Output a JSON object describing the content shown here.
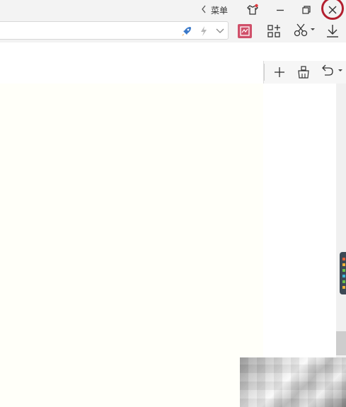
{
  "titlebar": {
    "menu_label": "菜单",
    "icons": [
      "chevron-left-icon",
      "skin-shirt-icon",
      "minimize-icon",
      "restore-icon",
      "close-icon"
    ],
    "close_highlight_color": "#b32030"
  },
  "address_bar": {
    "value": "",
    "icons": [
      "rocket-icon",
      "lightning-icon",
      "chevron-down-icon"
    ]
  },
  "toolbar": {
    "icons": [
      "red-extension-icon",
      "apps-grid-plus-icon",
      "scissors-icon",
      "download-icon"
    ]
  },
  "sidebar_toolbar": {
    "icons": [
      "plus-icon",
      "clear-broom-icon",
      "undo-icon"
    ]
  },
  "colors": {
    "accent_red": "#d0506a",
    "close_ring": "#b32030"
  }
}
